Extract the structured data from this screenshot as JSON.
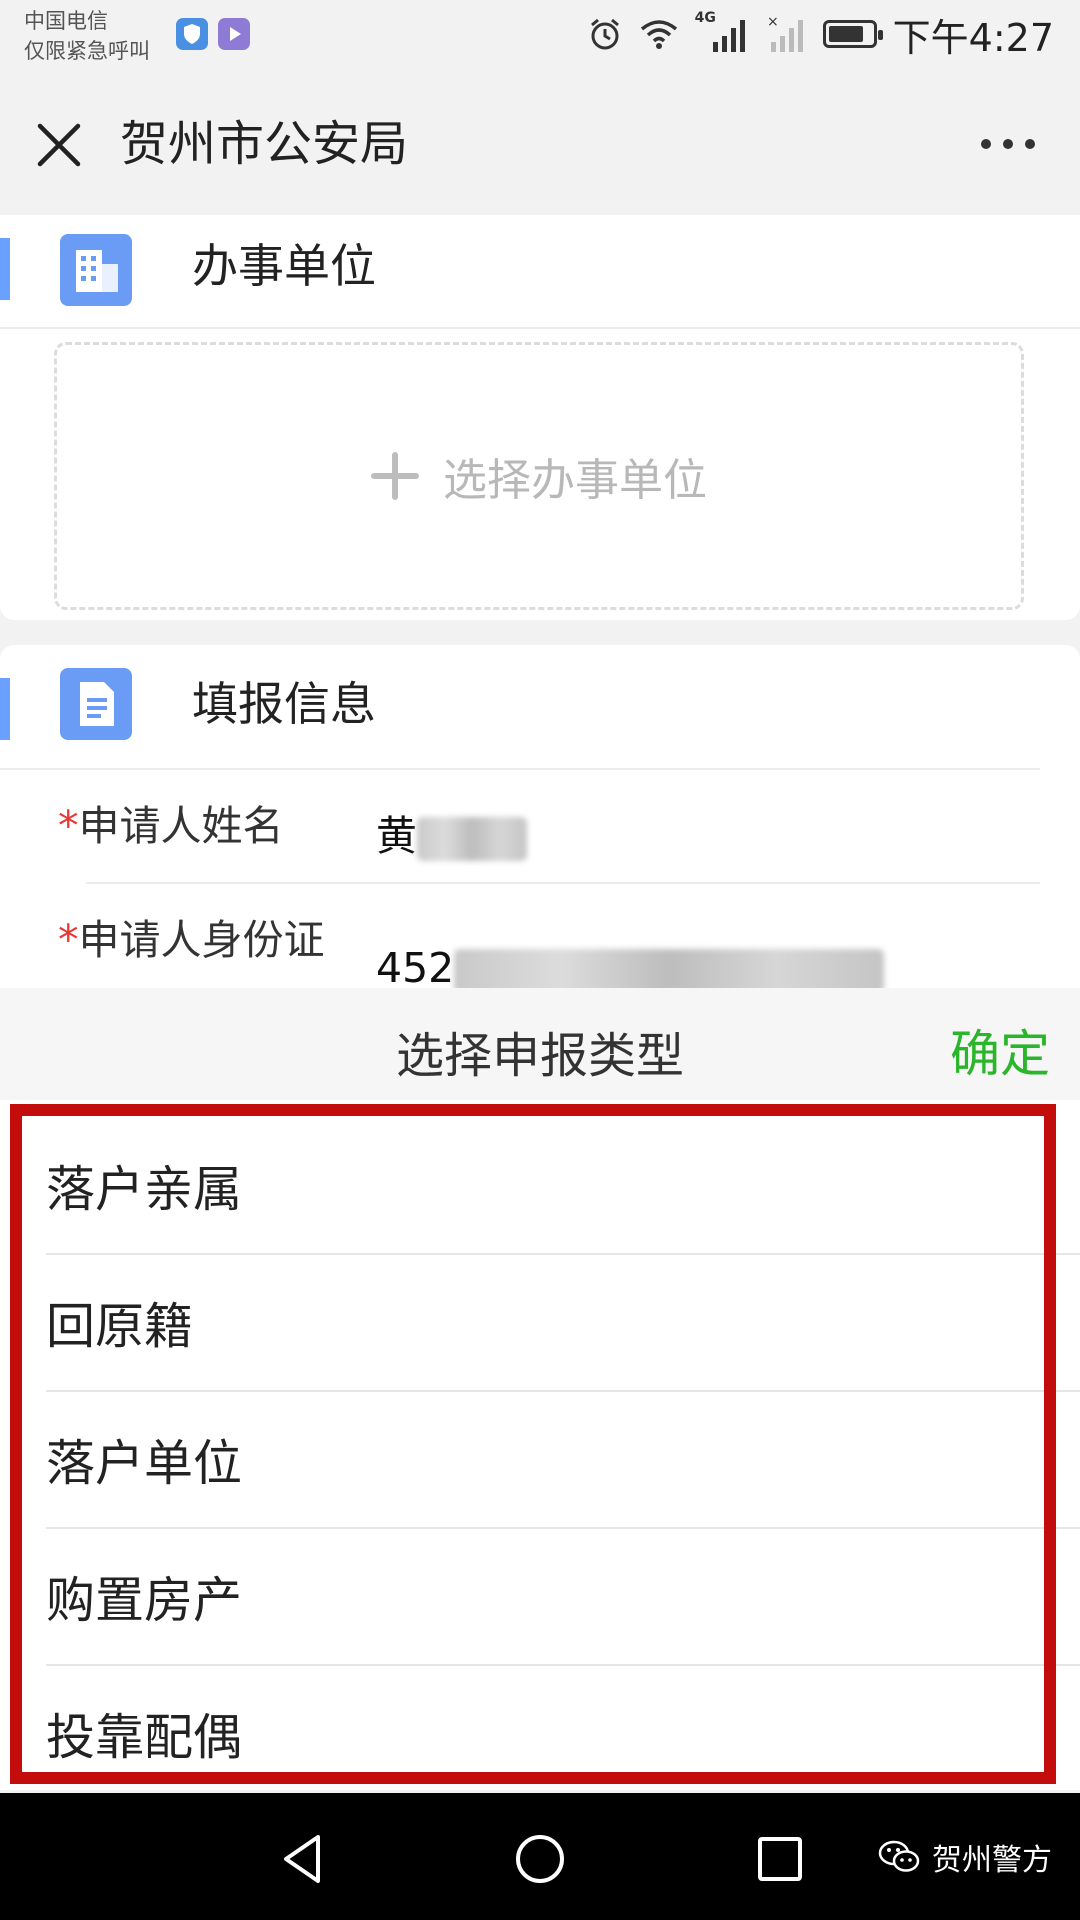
{
  "status_bar": {
    "carrier_line1": "中国电信",
    "carrier_line2": "仅限紧急呼叫",
    "network": "4G",
    "time": "下午4:27",
    "battery_level": 0.8
  },
  "title_bar": {
    "title": "贺州市公安局"
  },
  "office_section": {
    "title": "办事单位",
    "select_label": "选择办事单位"
  },
  "form_section": {
    "title": "填报信息",
    "fields": [
      {
        "required_mark": "*",
        "label": "申请人姓名",
        "value_visible": "黄"
      },
      {
        "required_mark": "*",
        "label": "申请人身份证",
        "value_visible": "452"
      }
    ]
  },
  "sheet": {
    "title": "选择申报类型",
    "confirm_label": "确定",
    "options": [
      "落户亲属",
      "回原籍",
      "落户单位",
      "购置房产",
      "投靠配偶"
    ]
  },
  "watermark": {
    "text": "贺州警方"
  },
  "colors": {
    "accent_blue": "#6b9cf5",
    "confirm_green": "#2bb52b",
    "highlight_red": "#c30d0d",
    "required_red": "#e53935"
  }
}
